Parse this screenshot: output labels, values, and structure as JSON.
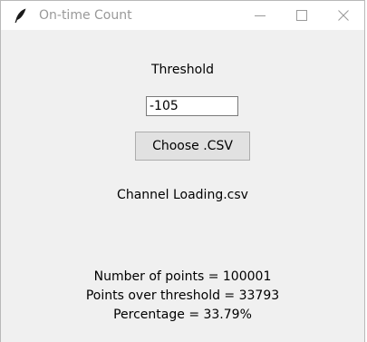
{
  "window": {
    "title": "On-time Count",
    "icon": "feather-icon",
    "controls": [
      "minimize-icon",
      "maximize-icon",
      "close-icon"
    ]
  },
  "form": {
    "threshold_label": "Threshold",
    "threshold_value": "-105",
    "choose_button_label": "Choose .CSV",
    "filename": "Channel Loading.csv"
  },
  "results": {
    "points_line": "Number of points = 100001",
    "over_line": "Points over threshold = 33793",
    "percentage_line": "Percentage = 33.79%"
  },
  "colors": {
    "window_background": "#f0f0f0",
    "titlebar_background": "#ffffff",
    "title_text": "#999999",
    "button_background": "#e1e1e1"
  }
}
